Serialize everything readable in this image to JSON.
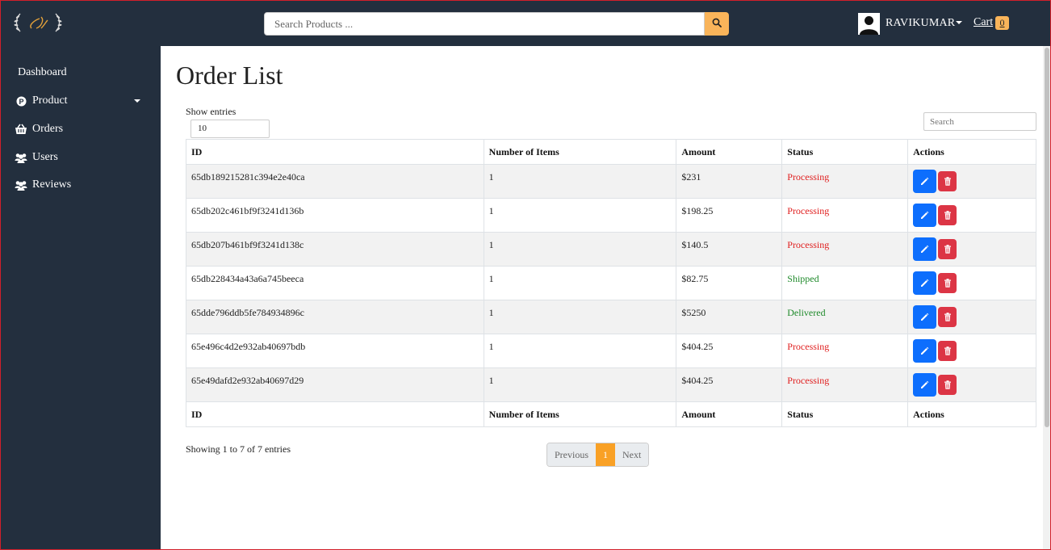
{
  "header": {
    "search_placeholder": "Search Products ...",
    "user_name": "RAVIKUMAR",
    "cart_label": "Cart",
    "cart_count": "0",
    "accent_color": "#f9b45a",
    "bg_color": "#232f3e"
  },
  "sidebar": {
    "items": [
      {
        "label": "Dashboard",
        "icon": "none"
      },
      {
        "label": "Product",
        "icon": "product-p-icon"
      },
      {
        "label": "Orders",
        "icon": "basket-icon"
      },
      {
        "label": "Users",
        "icon": "users-icon"
      },
      {
        "label": "Reviews",
        "icon": "users-icon"
      }
    ]
  },
  "main": {
    "title": "Order List",
    "show_entries_label": "Show entries",
    "entries_value": "10",
    "search_placeholder": "Search",
    "columns": [
      "ID",
      "Number of Items",
      "Amount",
      "Status",
      "Actions"
    ],
    "rows": [
      {
        "id": "65db189215281c394e2e40ca",
        "items": "1",
        "amount": "$231",
        "status": "Processing"
      },
      {
        "id": "65db202c461bf9f3241d136b",
        "items": "1",
        "amount": "$198.25",
        "status": "Processing"
      },
      {
        "id": "65db207b461bf9f3241d138c",
        "items": "1",
        "amount": "$140.5",
        "status": "Processing"
      },
      {
        "id": "65db228434a43a6a745beeca",
        "items": "1",
        "amount": "$82.75",
        "status": "Shipped"
      },
      {
        "id": "65dde796ddb5fe784934896c",
        "items": "1",
        "amount": "$5250",
        "status": "Delivered"
      },
      {
        "id": "65e496c4d2e932ab40697bdb",
        "items": "1",
        "amount": "$404.25",
        "status": "Processing"
      },
      {
        "id": "65e49dafd2e932ab40697d29",
        "items": "1",
        "amount": "$404.25",
        "status": "Processing"
      }
    ],
    "info": "Showing 1 to 7 of 7 entries",
    "pager": {
      "previous": "Previous",
      "current": "1",
      "next": "Next"
    },
    "status_colors": {
      "processing": "#e02020",
      "shipped": "#1f8a2b",
      "delivered": "#1f8a2b"
    }
  }
}
